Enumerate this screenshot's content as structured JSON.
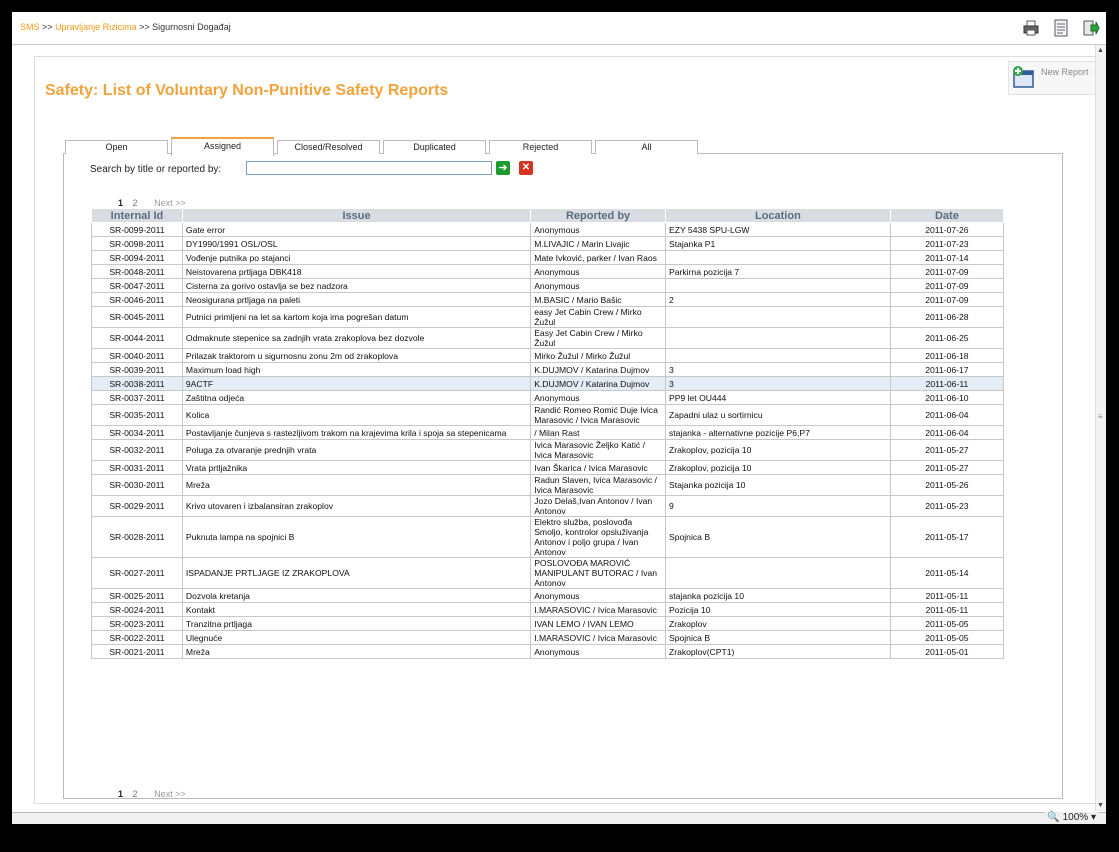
{
  "breadcrumb": {
    "root": "SMS",
    "sep1": ">>",
    "section": "Upravljanje Rizicima",
    "sep2": ">>",
    "current": "Sigurnosni Događaj"
  },
  "toolbar": {
    "icons": [
      "printer-icon",
      "document-icon",
      "exit-icon"
    ]
  },
  "page": {
    "title": "Safety: List of Voluntary Non-Punitive Safety Reports"
  },
  "new_report": {
    "label": "New Report"
  },
  "tabs": [
    {
      "label": "Open"
    },
    {
      "label": "Assigned"
    },
    {
      "label": "Closed/Resolved"
    },
    {
      "label": "Duplicated"
    },
    {
      "label": "Rejected"
    },
    {
      "label": "All"
    }
  ],
  "active_tab": "Assigned",
  "search": {
    "label": "Search by title or reported by:",
    "value": "",
    "placeholder": ""
  },
  "pager": {
    "current": "1",
    "other": "2",
    "next": "Next >>"
  },
  "table": {
    "columns": [
      "Internal Id",
      "Issue",
      "Reported by",
      "Location",
      "Date"
    ],
    "rows": [
      {
        "id": "SR-0099-2011",
        "issue": "Gate error",
        "reported_by": "Anonymous",
        "location": "EZY 5438 SPU-LGW",
        "date": "2011-07-26"
      },
      {
        "id": "SR-0098-2011",
        "issue": "DY1990/1991 OSL/OSL",
        "reported_by": "M.LIVAJIC / Marin Livajic",
        "location": "Stajanka P1",
        "date": "2011-07-23"
      },
      {
        "id": "SR-0094-2011",
        "issue": "Vođenje putnika po stajanci",
        "reported_by": "Mate Ivković, parker / Ivan Raos",
        "location": "",
        "date": "2011-07-14"
      },
      {
        "id": "SR-0048-2011",
        "issue": "Neistovarena prtljaga DBK418",
        "reported_by": "Anonymous",
        "location": "Parkirna pozicija 7",
        "date": "2011-07-09"
      },
      {
        "id": "SR-0047-2011",
        "issue": "Cisterna za gorivo ostavlja se bez nadzora",
        "reported_by": "Anonymous",
        "location": "",
        "date": "2011-07-09"
      },
      {
        "id": "SR-0046-2011",
        "issue": "Neosigurana prtljaga na paleti",
        "reported_by": "M.BASIC / Mario Bašic",
        "location": "2",
        "date": "2011-07-09"
      },
      {
        "id": "SR-0045-2011",
        "issue": "Putnici primljeni na let sa kartom koja ima pogrešan datum",
        "reported_by": "easy Jet Cabin Crew / Mirko Žužul",
        "location": "",
        "date": "2011-06-28"
      },
      {
        "id": "SR-0044-2011",
        "issue": "Odmaknute stepenice sa zadnjih vrata zrakoplova bez dozvole",
        "reported_by": "Easy Jet Cabin Crew / Mirko Žužul",
        "location": "",
        "date": "2011-06-25"
      },
      {
        "id": "SR-0040-2011",
        "issue": "Prilazak traktorom u sigurnosnu zonu 2m od zrakoplova",
        "reported_by": "Mirko Žužul / Mirko Žužul",
        "location": "",
        "date": "2011-06-18"
      },
      {
        "id": "SR-0039-2011",
        "issue": "Maximum load high",
        "reported_by": "K.DUJMOV / Katarina Dujmov",
        "location": "3",
        "date": "2011-06-17"
      },
      {
        "id": "SR-0038-2011",
        "issue": "9ACTF",
        "reported_by": "K.DUJMOV / Katarina Dujmov",
        "location": "3",
        "date": "2011-06-11"
      },
      {
        "id": "SR-0037-2011",
        "issue": "Zaštitna odjeća",
        "reported_by": "Anonymous",
        "location": "PP9 let OU444",
        "date": "2011-06-10"
      },
      {
        "id": "SR-0035-2011",
        "issue": "Kolica",
        "reported_by": "Randić Romeo Romić Duje Ivica Marasovic / Ivica Marasovic",
        "location": "Zapadni ulaz u sortirnicu",
        "date": "2011-06-04"
      },
      {
        "id": "SR-0034-2011",
        "issue": "Postavljanje čunjeva s rastezljivom trakom na krajevima krila i spoja sa stepenicama",
        "reported_by": "/ Milan Rast",
        "location": "stajanka - alternativne pozicije P6,P7",
        "date": "2011-06-04"
      },
      {
        "id": "SR-0032-2011",
        "issue": "Poluga za otvaranje prednjih vrata",
        "reported_by": "Ivica Marasovic Željko Katić / Ivica Marasovic",
        "location": "Zrakoplov, pozicija 10",
        "date": "2011-05-27"
      },
      {
        "id": "SR-0031-2011",
        "issue": "Vrata prtljažnika",
        "reported_by": "Ivan Škarica / Ivica Marasovic",
        "location": "Zrakoplov, pozicija 10",
        "date": "2011-05-27"
      },
      {
        "id": "SR-0030-2011",
        "issue": "Mreža",
        "reported_by": "Radun Slaven, Ivica Marasovic / Ivica Marasovic",
        "location": "Stajanka pozicija 10",
        "date": "2011-05-26"
      },
      {
        "id": "SR-0029-2011",
        "issue": "Krivo utovaren i izbalansiran zrakoplov",
        "reported_by": "Jozo Delaš,Ivan Antonov / Ivan Antonov",
        "location": "9",
        "date": "2011-05-23"
      },
      {
        "id": "SR-0028-2011",
        "issue": "Puknuta lampa na spojnici B",
        "reported_by": "Elektro služba, poslovođa Smoljo, kontrolor opsluživanja Antonov i poljo grupa / Ivan Antonov",
        "location": "Spojnica B",
        "date": "2011-05-17"
      },
      {
        "id": "SR-0027-2011",
        "issue": "ISPADANJE PRTLJAGE IZ ZRAKOPLOVA",
        "reported_by": "POSLOVOĐA MAROVIĆ MANIPULANT BUTORAC / Ivan Antonov",
        "location": "",
        "date": "2011-05-14"
      },
      {
        "id": "SR-0025-2011",
        "issue": "Dozvola kretanja",
        "reported_by": "Anonymous",
        "location": "stajanka pozicija 10",
        "date": "2011-05-11"
      },
      {
        "id": "SR-0024-2011",
        "issue": "Kontakt",
        "reported_by": "I.MARASOVIC / Ivica Marasovic",
        "location": "Pozicija 10",
        "date": "2011-05-11"
      },
      {
        "id": "SR-0023-2011",
        "issue": "Tranzitna prtljaga",
        "reported_by": "IVAN LEMO / IVAN LEMO",
        "location": "Zrakoplov",
        "date": "2011-05-05"
      },
      {
        "id": "SR-0022-2011",
        "issue": "Ulegnuće",
        "reported_by": "I.MARASOVIC / Ivica Marasovic",
        "location": "Spojnica B",
        "date": "2011-05-05"
      },
      {
        "id": "SR-0021-2011",
        "issue": "Mreža",
        "reported_by": "Anonymous",
        "location": "Zrakoplov(CPT1)",
        "date": "2011-05-01"
      }
    ]
  },
  "statusbar": {
    "zoom": "100%"
  },
  "colors": {
    "accent": "#f2a33c",
    "header_bg": "#d9dde2",
    "header_text": "#5b6d82",
    "row_highlight": "#e4ecf5"
  }
}
